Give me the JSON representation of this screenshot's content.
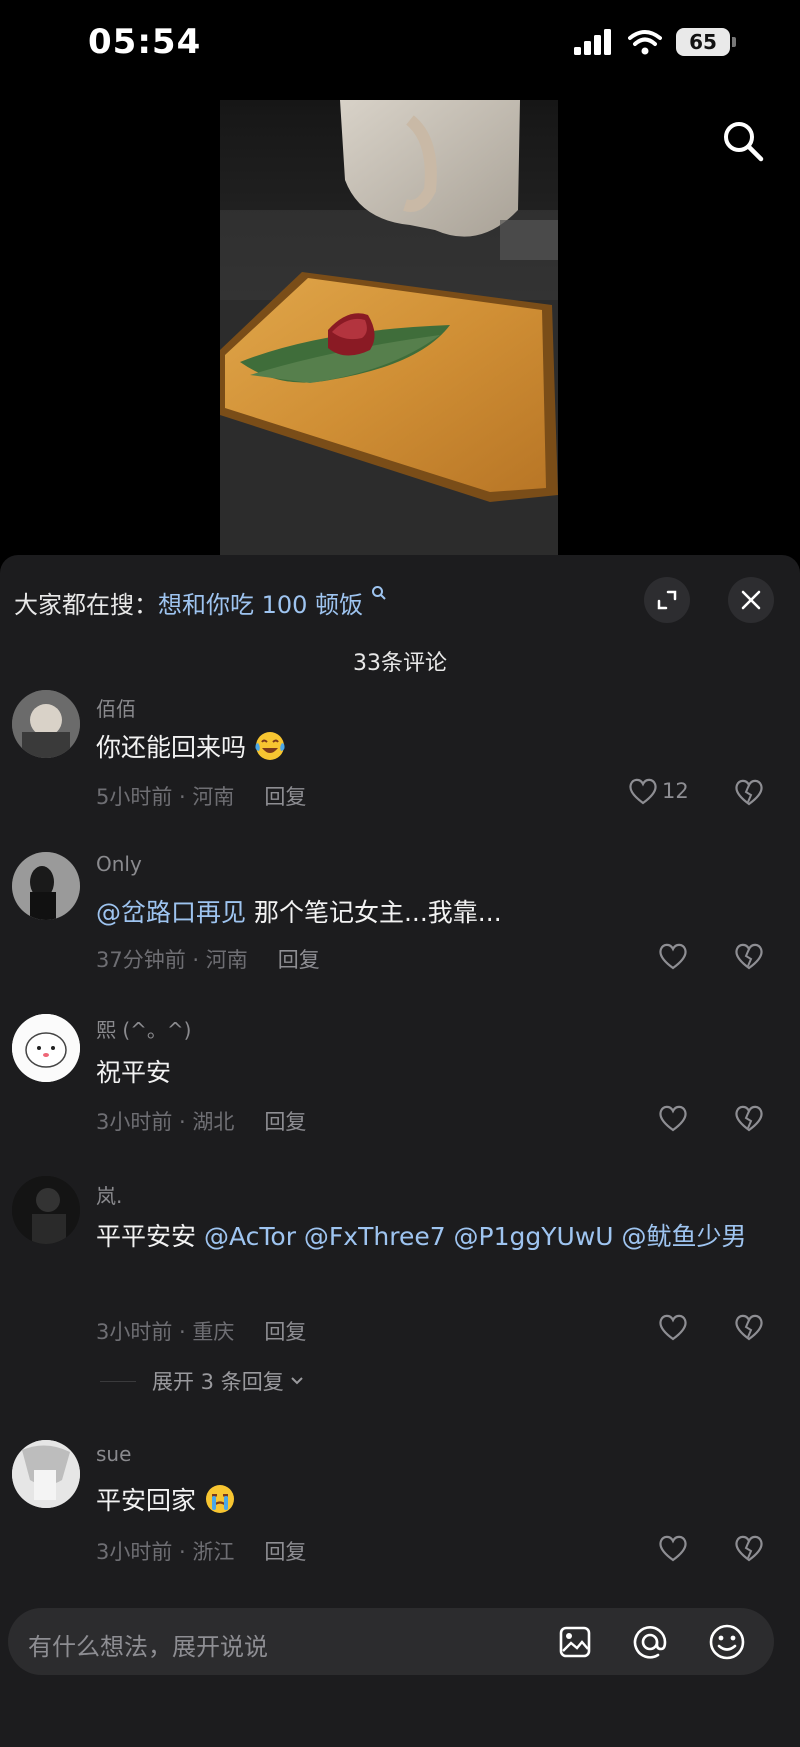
{
  "status_bar": {
    "time": "05:54",
    "battery": "65"
  },
  "comments_panel": {
    "trending_prefix": "大家都在搜：",
    "trending_keyword": "想和你吃 100 顿饭",
    "comment_count": "33条评论",
    "comments": [
      {
        "username": "佰佰",
        "text": "你还能回来吗",
        "emoji": "laughing-tears-emoji",
        "time_location": "5小时前 · 河南",
        "reply": "回复",
        "likes": "12"
      },
      {
        "username": "Only",
        "mention": "@岔路口再见",
        "text": " 那个笔记女主...我靠...",
        "time_location": "37分钟前 · 河南",
        "reply": "回复",
        "likes": ""
      },
      {
        "username": "熙 (^。^)",
        "text": "祝平安",
        "time_location": "3小时前 · 湖北",
        "reply": "回复",
        "likes": ""
      },
      {
        "username": "岚.",
        "text": "平平安安",
        "mentions": "@AcTor @FxThree7 @P1ggYUwU @鱿鱼少男",
        "time_location": "3小时前 · 重庆",
        "reply": "回复",
        "likes": "",
        "expand_replies": "展开 3 条回复"
      },
      {
        "username": "sue",
        "text": "平安回家",
        "emoji": "crying-emoji",
        "time_location": "3小时前 · 浙江",
        "reply": "回复",
        "likes": ""
      }
    ]
  },
  "input": {
    "placeholder": "有什么想法，展开说说"
  },
  "colors": {
    "sheet_bg": "#1c1c1e",
    "mention": "#9ec4f0",
    "meta": "#6e6e73",
    "input_bg": "#2c2c2e"
  }
}
